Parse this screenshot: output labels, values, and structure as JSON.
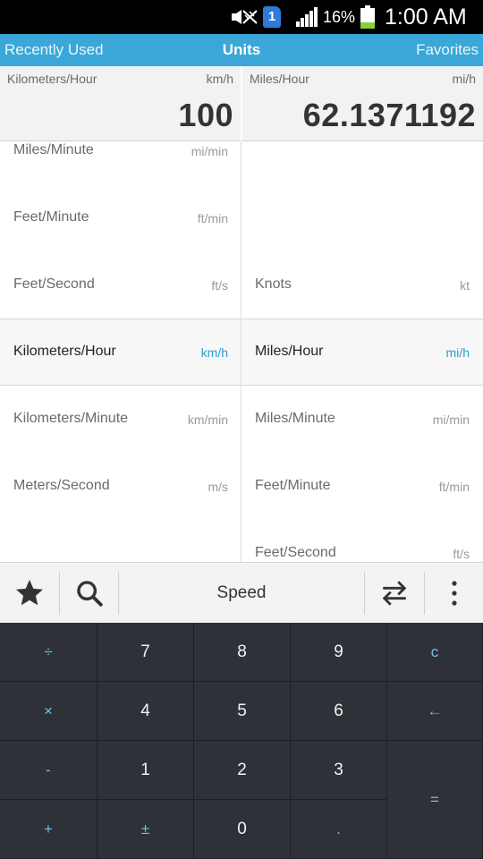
{
  "status_bar": {
    "battery_percent": "16%",
    "time": "1:00 AM",
    "sim_label": "1",
    "icons": [
      "mute-icon",
      "sim-icon",
      "signal-icon",
      "battery-icon"
    ]
  },
  "action_bar": {
    "left": "Recently Used",
    "title": "Units",
    "right": "Favorites",
    "color": "#3aa7d8"
  },
  "from_panel": {
    "name": "Kilometers/Hour",
    "abbr": "km/h",
    "value": "100"
  },
  "to_panel": {
    "name": "Miles/Hour",
    "abbr": "mi/h",
    "value": "62.1371192"
  },
  "left_list": [
    {
      "name": "Miles/Minute",
      "abbr": "mi/min",
      "selected": false
    },
    {
      "name": "Feet/Minute",
      "abbr": "ft/min",
      "selected": false
    },
    {
      "name": "Feet/Second",
      "abbr": "ft/s",
      "selected": false
    },
    {
      "name": "Kilometers/Hour",
      "abbr": "km/h",
      "selected": true
    },
    {
      "name": "Kilometers/Minute",
      "abbr": "km/min",
      "selected": false
    },
    {
      "name": "Meters/Second",
      "abbr": "m/s",
      "selected": false
    }
  ],
  "right_list": [
    {
      "name": "",
      "abbr": "",
      "selected": false
    },
    {
      "name": "",
      "abbr": "",
      "selected": false
    },
    {
      "name": "Knots",
      "abbr": "kt",
      "selected": false
    },
    {
      "name": "Miles/Hour",
      "abbr": "mi/h",
      "selected": true
    },
    {
      "name": "Miles/Minute",
      "abbr": "mi/min",
      "selected": false
    },
    {
      "name": "Feet/Minute",
      "abbr": "ft/min",
      "selected": false
    },
    {
      "name": "Feet/Second",
      "abbr": "ft/s",
      "selected": false
    }
  ],
  "toolbar": {
    "category": "Speed",
    "icons": [
      "star-icon",
      "search-icon",
      "swap-icon",
      "more-icon"
    ]
  },
  "keypad": {
    "divide": "÷",
    "seven": "7",
    "eight": "8",
    "nine": "9",
    "clear": "c",
    "multiply": "×",
    "four": "4",
    "five": "5",
    "six": "6",
    "backspace": "←",
    "minus": "-",
    "one": "1",
    "two": "2",
    "three": "3",
    "equals": "=",
    "plus": "+",
    "plus_minus": "±",
    "zero": "0",
    "decimal": "."
  },
  "accent_color": "#2e9ad0"
}
